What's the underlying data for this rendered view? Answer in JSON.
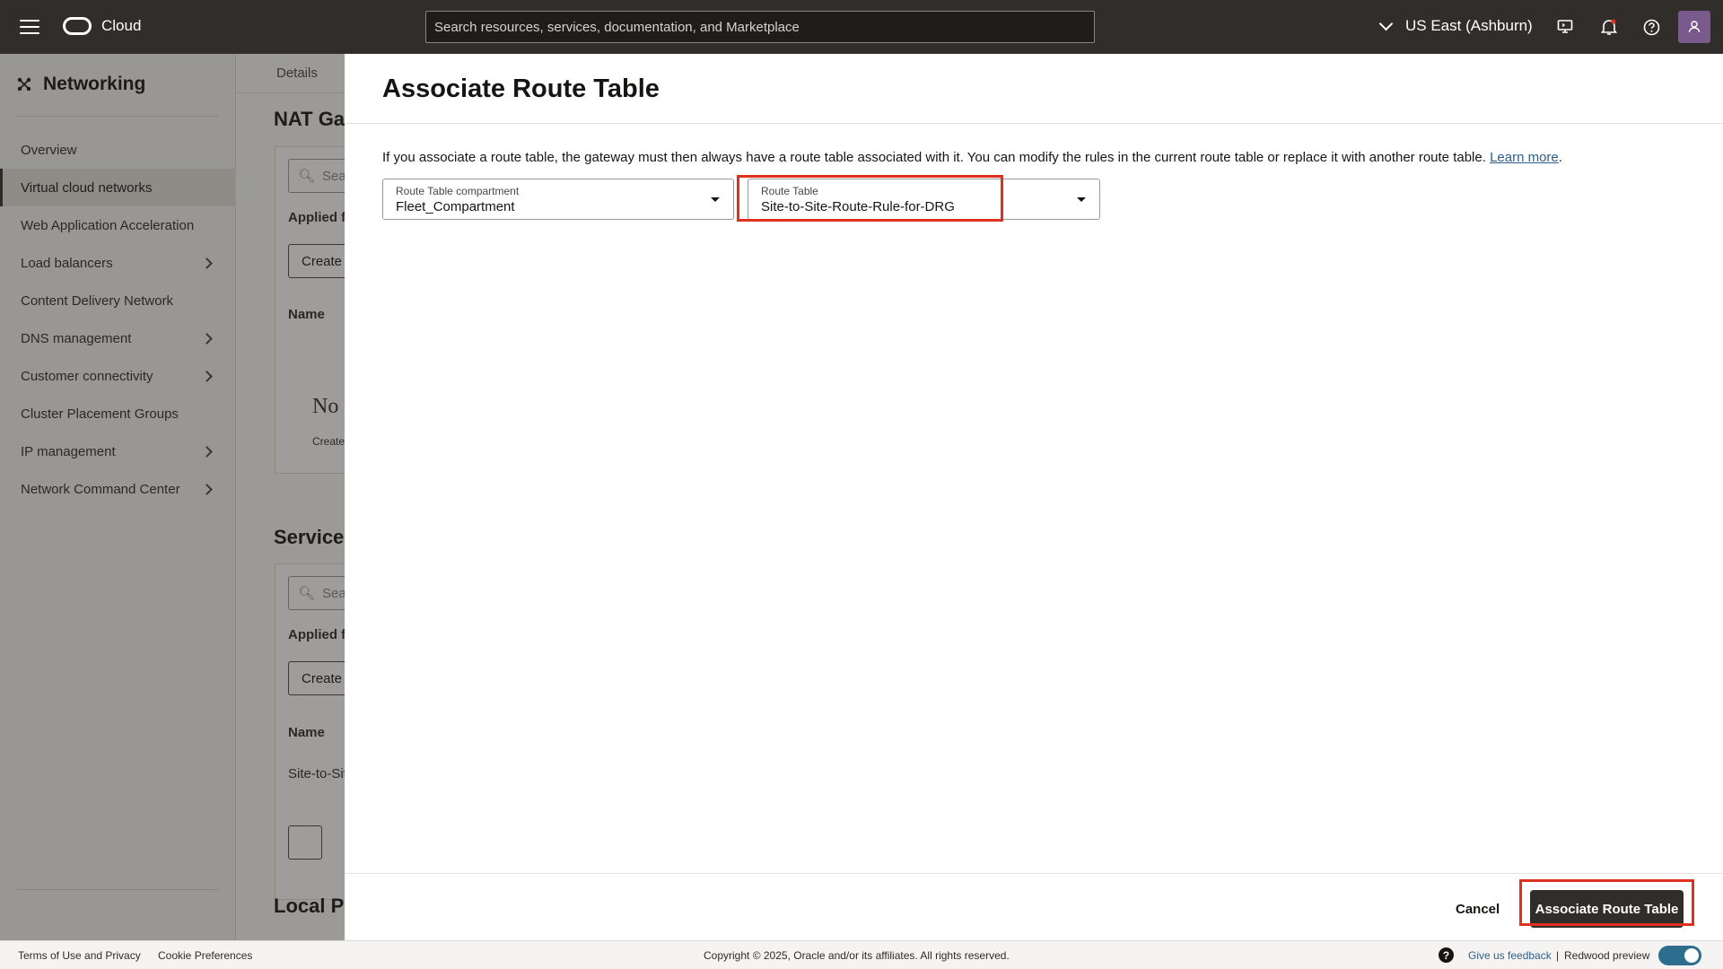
{
  "header": {
    "brand": "Cloud",
    "search_placeholder": "Search resources, services, documentation, and Marketplace",
    "region": "US East (Ashburn)"
  },
  "sidebar": {
    "title": "Networking",
    "items": [
      {
        "label": "Overview",
        "has_children": false
      },
      {
        "label": "Virtual cloud networks",
        "has_children": false,
        "active": true
      },
      {
        "label": "Web Application Acceleration",
        "has_children": false
      },
      {
        "label": "Load balancers",
        "has_children": true
      },
      {
        "label": "Content Delivery Network",
        "has_children": false
      },
      {
        "label": "DNS management",
        "has_children": true
      },
      {
        "label": "Customer connectivity",
        "has_children": true
      },
      {
        "label": "Cluster Placement Groups",
        "has_children": false
      },
      {
        "label": "IP management",
        "has_children": true
      },
      {
        "label": "Network Command Center",
        "has_children": true
      }
    ]
  },
  "background": {
    "tab": "Details",
    "section1": "NAT Gat",
    "search_partial": "Sea",
    "applied_filters": "Applied fi",
    "create_btn1": "Create I",
    "col_name": "Name",
    "empty_title": "No",
    "empty_sub": "Create",
    "section2": "Service",
    "create_btn2": "Create S",
    "row_value": "Site-to-Sit",
    "section3": "Local Pe"
  },
  "panel": {
    "title": "Associate Route Table",
    "description": "If you associate a route table, the gateway must then always have a route table associated with it. You can modify the rules in the current route table or replace it with another route table.",
    "learn_more": "Learn more",
    "compartment_label": "Route Table compartment",
    "compartment_value": "Fleet_Compartment",
    "route_table_label": "Route Table",
    "route_table_value": "Site-to-Site-Route-Rule-for-DRG",
    "cancel_label": "Cancel",
    "submit_label": "Associate Route Table"
  },
  "footer": {
    "terms": "Terms of Use and Privacy",
    "cookies": "Cookie Preferences",
    "copyright": "Copyright © 2025, Oracle and/or its affiliates. All rights reserved.",
    "feedback": "Give us feedback",
    "separator": "|",
    "redwood": "Redwood preview"
  },
  "colors": {
    "topbar": "#312d2a",
    "highlight": "#e0311f",
    "primary_button": "#312d2a",
    "link": "#2d5e8e"
  }
}
